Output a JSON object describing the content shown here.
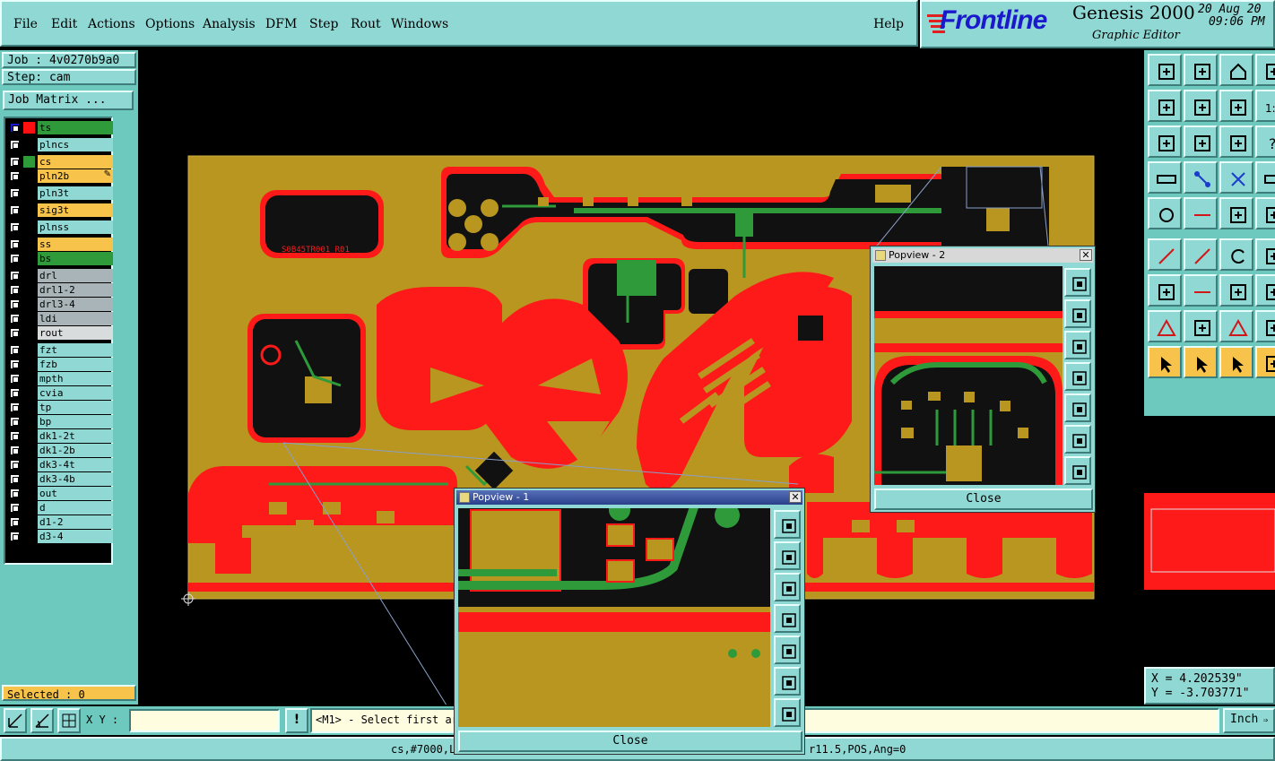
{
  "menu": {
    "items": [
      "File",
      "Edit",
      "Actions",
      "Options",
      "Analysis",
      "DFM",
      "Step",
      "Rout",
      "Windows"
    ],
    "help": "Help"
  },
  "branding": {
    "logo": "Frontline",
    "product": "Genesis 2000",
    "subtitle": "Graphic Editor",
    "date": "20 Aug 20",
    "time": "09:06 PM"
  },
  "job": {
    "job_label": "Job : 4v0270b9a0",
    "step_label": "Step: cam",
    "matrix_button": "Job Matrix ..."
  },
  "layers": [
    {
      "name": "ts",
      "color": "#2e9a3a",
      "swatch": "#ff1010",
      "active": true
    },
    {
      "name": "plncs",
      "color": "#8fd8d4"
    },
    {
      "name": "cs",
      "color": "#f7c34a",
      "swatch": "#2e9a3a"
    },
    {
      "name": "pln2b",
      "color": "#f7c34a",
      "flag": "✎"
    },
    {
      "name": "pln3t",
      "color": "#8fd8d4"
    },
    {
      "name": "sig3t",
      "color": "#f7c34a"
    },
    {
      "name": "plnss",
      "color": "#8fd8d4"
    },
    {
      "name": "ss",
      "color": "#f7c34a"
    },
    {
      "name": "bs",
      "color": "#2e9a3a"
    },
    {
      "name": "drl",
      "color": "#a8b4b8"
    },
    {
      "name": "drl1-2",
      "color": "#a8b4b8"
    },
    {
      "name": "drl3-4",
      "color": "#a8b4b8"
    },
    {
      "name": "ldi",
      "color": "#a8b4b8"
    },
    {
      "name": "rout",
      "color": "#d8dcdc"
    },
    {
      "name": "fzt",
      "color": "#8fd8d4"
    },
    {
      "name": "fzb",
      "color": "#8fd8d4"
    },
    {
      "name": "mpth",
      "color": "#8fd8d4"
    },
    {
      "name": "cvia",
      "color": "#8fd8d4"
    },
    {
      "name": "tp",
      "color": "#8fd8d4"
    },
    {
      "name": "bp",
      "color": "#8fd8d4"
    },
    {
      "name": "dk1-2t",
      "color": "#8fd8d4"
    },
    {
      "name": "dk1-2b",
      "color": "#8fd8d4"
    },
    {
      "name": "dk3-4t",
      "color": "#8fd8d4"
    },
    {
      "name": "dk3-4b",
      "color": "#8fd8d4"
    },
    {
      "name": "out",
      "color": "#8fd8d4"
    },
    {
      "name": "d",
      "color": "#8fd8d4"
    },
    {
      "name": "d1-2",
      "color": "#8fd8d4"
    },
    {
      "name": "d3-4",
      "color": "#8fd8d4"
    }
  ],
  "selected": "Selected : 0",
  "pcb": {
    "silk_text": "S0B45TR001 R01",
    "colors": {
      "copper": "#b8961f",
      "red": "#ff1a1a",
      "green": "#2e9a3a",
      "dark": "#111111"
    }
  },
  "popview1": {
    "title": "Popview - 1",
    "close": "Close"
  },
  "popview2": {
    "title": "Popview - 2",
    "close": "Close"
  },
  "coords": {
    "x": "X = 4.202539\"",
    "y": "Y = -3.703771\""
  },
  "cmd": {
    "xy_label": "X Y :",
    "xy_value": "",
    "prompt": "<M1> - Select first ar",
    "units": "Inch"
  },
  "status": {
    "left": "cs,#7000,L",
    "right": "r11.5,POS,Ang=0"
  },
  "tool_icons": [
    "frame-icon",
    "zoom-in-icon",
    "home-icon",
    "zoom-fit-icon",
    "pan-left-icon",
    "pan-right-icon",
    "undo-zoom-icon",
    "one-to-two-icon",
    "expand-icon",
    "fit-center-icon",
    "ratio-icon",
    "help-icon",
    "measure-icon",
    "net-icon",
    "cross-icon",
    "ruler-icon",
    "circle-icon",
    "dash-icon",
    "route-icon",
    "arc-icon",
    "line-icon",
    "line-icon",
    "rotate-icon",
    "bracket-icon",
    "point-icon",
    "minus-icon",
    "dimension-icon",
    "square-icon",
    "triangle-icon",
    "angle-icon",
    "peak-icon",
    "dim-icon",
    "select-icon",
    "select-icon",
    "select-icon",
    "step-icon"
  ]
}
